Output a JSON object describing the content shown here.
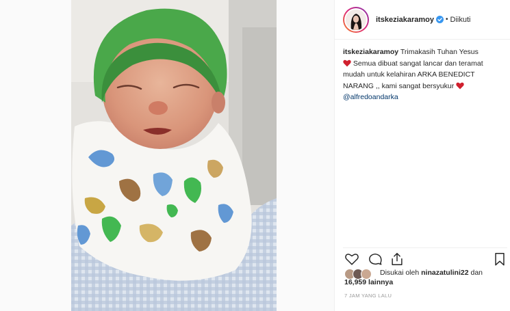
{
  "post": {
    "username": "itskeziakaramoy",
    "follow_state": "Diikuti",
    "separator": "•"
  },
  "caption": {
    "username": "itskeziakaramoy",
    "line1": "Trimakasih Tuhan Yesus",
    "line2": "Semua dibuat sangat lancar dan teramat mudah untuk kelahiran ARKA BENEDICT NARANG ,, kami sangat bersyukur",
    "mention": "@alfredoandarka"
  },
  "likes": {
    "prefix": "Disukai oleh",
    "user": "ninazatulini22",
    "conj": "dan",
    "count": "16,959 lainnya"
  },
  "timestamp": "7 JAM YANG LALU",
  "icons": {
    "verified": "verified-badge-icon",
    "heart": "red-heart-emoji-icon",
    "like": "heart-outline-icon",
    "comment": "comment-bubble-icon",
    "share": "share-icon",
    "save": "bookmark-icon"
  },
  "colors": {
    "verified_blue": "#3897f0",
    "heart_red": "#d0202e",
    "mention": "#003569",
    "timestamp": "#999999",
    "hat_green": "#4aa84a"
  }
}
